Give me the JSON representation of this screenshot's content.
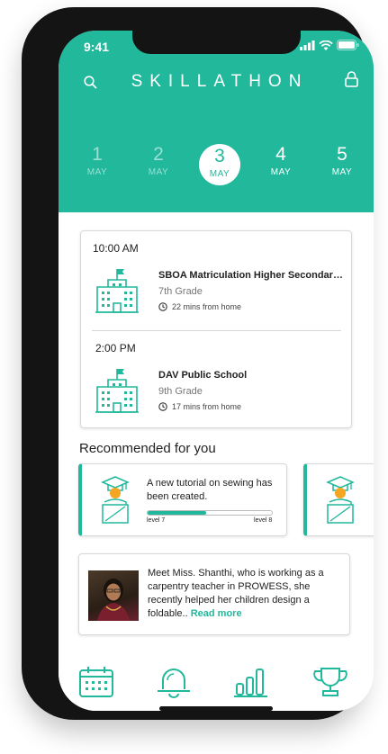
{
  "status_bar": {
    "time": "9:41"
  },
  "header": {
    "title": "SKILLATHON",
    "icons": {
      "left": "search-icon",
      "right": "lock-icon"
    },
    "accent_color": "#21b89c"
  },
  "dates": [
    {
      "day": "1",
      "month": "MAY",
      "selected": false
    },
    {
      "day": "2",
      "month": "MAY",
      "selected": false
    },
    {
      "day": "3",
      "month": "MAY",
      "selected": true
    },
    {
      "day": "4",
      "month": "MAY",
      "selected": false
    },
    {
      "day": "5",
      "month": "MAY",
      "selected": false
    }
  ],
  "schedule": [
    {
      "time": "10:00 AM",
      "school": "SBOA Matriculation Higher Secondary School",
      "grade": "7th Grade",
      "distance": "22 mins from home",
      "icon": "school-building-icon"
    },
    {
      "time": "2:00 PM",
      "school": "DAV Public School",
      "grade": "9th Grade",
      "distance": "17 mins from home",
      "icon": "school-building-icon"
    }
  ],
  "recommended": {
    "title": "Recommended for you",
    "cards": [
      {
        "text": "A new tutorial on sewing has been created.",
        "progress": 0.47,
        "level_from": "level 7",
        "level_to": "level 8",
        "icon": "graduate-icon"
      },
      {
        "text": "",
        "icon": "graduate-icon"
      }
    ]
  },
  "story": {
    "text": "Meet Miss. Shanthi, who is working as a carpentry teacher in PROWESS, she recently helped her children design a foldable..",
    "link": "Read more"
  },
  "tabbar": [
    "calendar-icon",
    "bell-icon",
    "bar-chart-icon",
    "trophy-icon"
  ]
}
